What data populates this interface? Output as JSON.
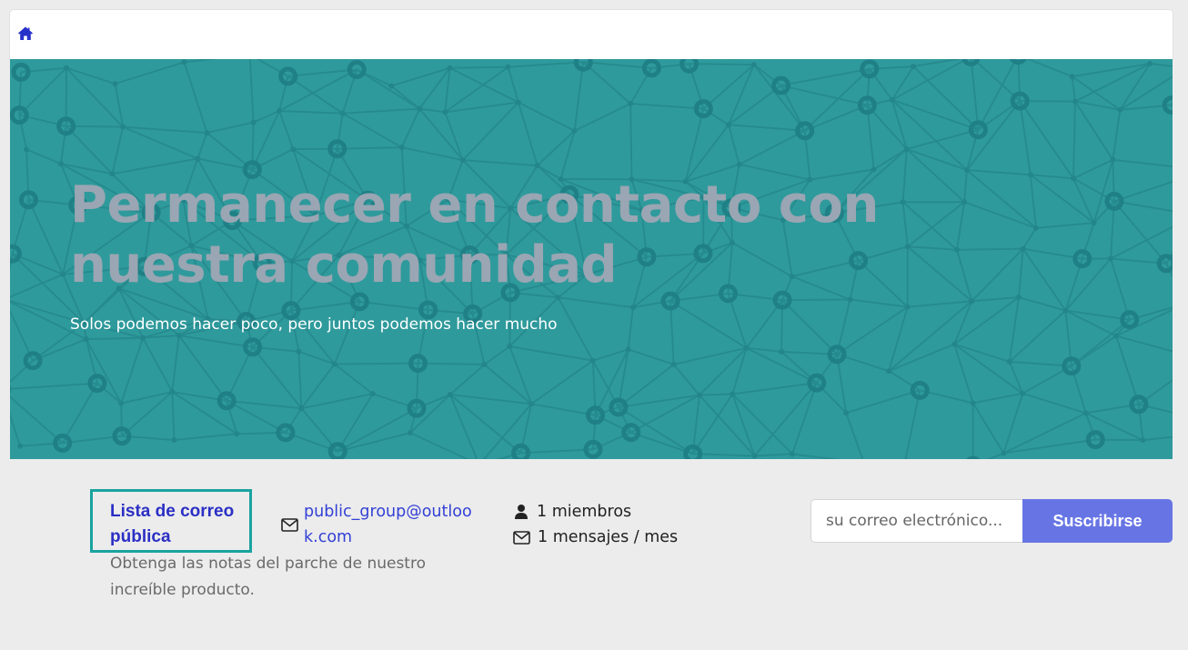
{
  "nav": {
    "home_icon": "home-icon"
  },
  "hero": {
    "title": "Permanecer en contacto con nuestra comunidad",
    "subtitle": "Solos podemos hacer poco, pero juntos podemos hacer mucho",
    "background_color": "#2f9a9c",
    "title_color": "#9aa6b3"
  },
  "mailing_list": {
    "name": "Lista de correo pública",
    "description": "Obtenga las notas del parche de nuestro increíble producto.",
    "email": "public_group@outlook.com",
    "email_icon": "envelope-icon"
  },
  "stats": {
    "members": "1 miembros",
    "members_icon": "user-icon",
    "messages": "1 mensajes / mes",
    "messages_icon": "envelope-icon"
  },
  "subscribe": {
    "placeholder": "su correo electrónico...",
    "button_label": "Suscribirse",
    "button_color": "#6775e4"
  },
  "colors": {
    "accent": "#2b2fc4",
    "highlight_border": "#1aa39f",
    "page_background": "#ececec"
  }
}
